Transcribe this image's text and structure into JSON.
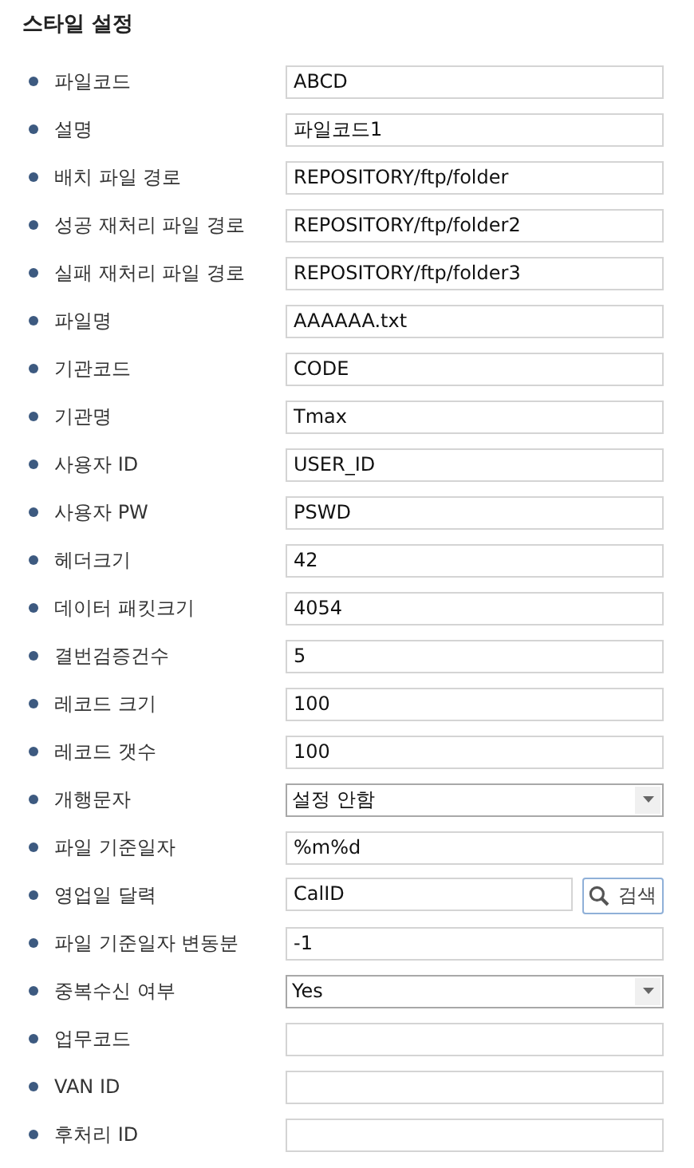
{
  "title": "스타일 설정",
  "fields": [
    {
      "label": "파일코드",
      "kind": "text",
      "value": "ABCD"
    },
    {
      "label": "설명",
      "kind": "text",
      "value": "파일코드1"
    },
    {
      "label": "배치 파일 경로",
      "kind": "text",
      "value": "REPOSITORY/ftp/folder"
    },
    {
      "label": "성공 재처리 파일 경로",
      "kind": "text",
      "value": "REPOSITORY/ftp/folder2"
    },
    {
      "label": "실패 재처리 파일 경로",
      "kind": "text",
      "value": "REPOSITORY/ftp/folder3"
    },
    {
      "label": "파일명",
      "kind": "text",
      "value": "AAAAAA.txt"
    },
    {
      "label": "기관코드",
      "kind": "text",
      "value": "CODE"
    },
    {
      "label": "기관명",
      "kind": "text",
      "value": "Tmax"
    },
    {
      "label": "사용자 ID",
      "kind": "text",
      "value": "USER_ID"
    },
    {
      "label": "사용자 PW",
      "kind": "text",
      "value": "PSWD"
    },
    {
      "label": "헤더크기",
      "kind": "text",
      "value": "42"
    },
    {
      "label": "데이터 패킷크기",
      "kind": "text",
      "value": "4054"
    },
    {
      "label": "결번검증건수",
      "kind": "text",
      "value": "5"
    },
    {
      "label": "레코드 크기",
      "kind": "text",
      "value": "100"
    },
    {
      "label": "레코드 갯수",
      "kind": "text",
      "value": "100"
    },
    {
      "label": "개행문자",
      "kind": "select",
      "value": "설정 안함"
    },
    {
      "label": "파일 기준일자",
      "kind": "text",
      "value": "%m%d"
    },
    {
      "label": "영업일 달력",
      "kind": "search",
      "value": "CalID",
      "button": "검색"
    },
    {
      "label": "파일 기준일자 변동분",
      "kind": "text",
      "value": "-1"
    },
    {
      "label": "중복수신 여부",
      "kind": "select",
      "value": "Yes"
    },
    {
      "label": "업무코드",
      "kind": "text"
    },
    {
      "label": "VAN ID",
      "kind": "text"
    },
    {
      "label": "후처리 ID",
      "kind": "text"
    }
  ]
}
